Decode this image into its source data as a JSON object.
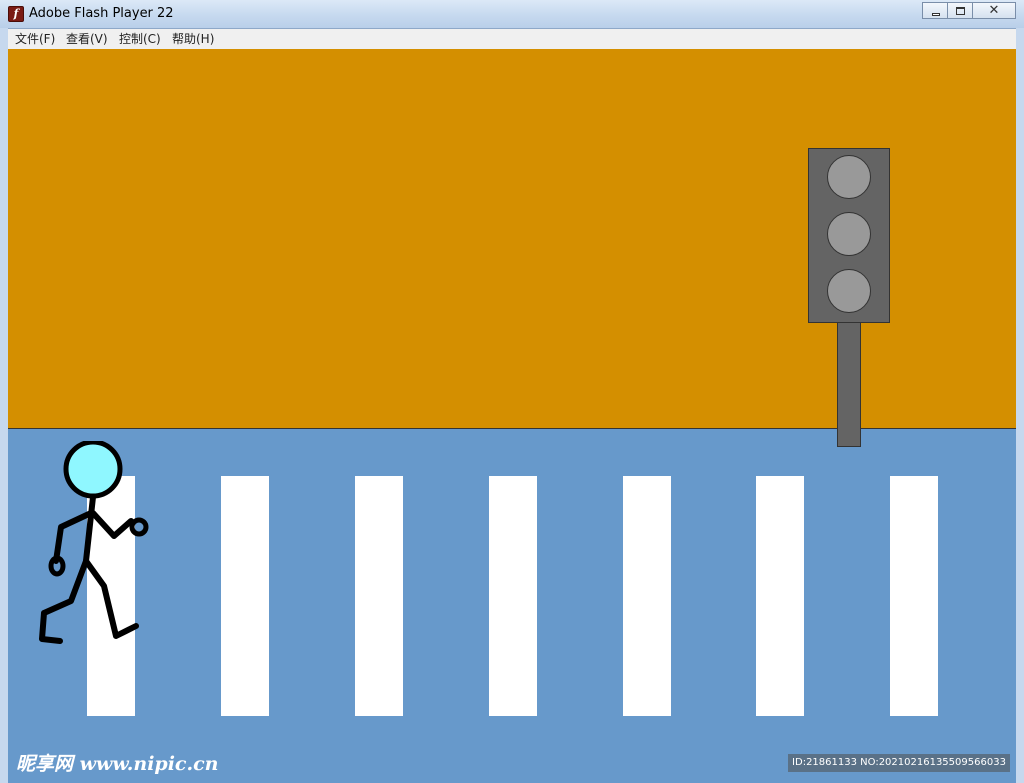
{
  "window": {
    "title": "Adobe Flash Player 22",
    "close_glyph": "✕"
  },
  "menu": {
    "items": [
      "文件(F)",
      "查看(V)",
      "控制(C)",
      "帮助(H)"
    ]
  },
  "scene": {
    "sky_color": "#d48f00",
    "road_color": "#6799cb",
    "stripe_color": "#ffffff",
    "traffic_light": {
      "lamp_count": 3,
      "lamp_color": "#999999",
      "body_color": "#646464"
    },
    "pedestrian": {
      "head_color": "#8ff7ff",
      "state": "walking"
    }
  },
  "watermark": {
    "logo": "昵享网 www.nipic.cn",
    "id_text": "ID:21861133 NO:20210216135509566033"
  }
}
